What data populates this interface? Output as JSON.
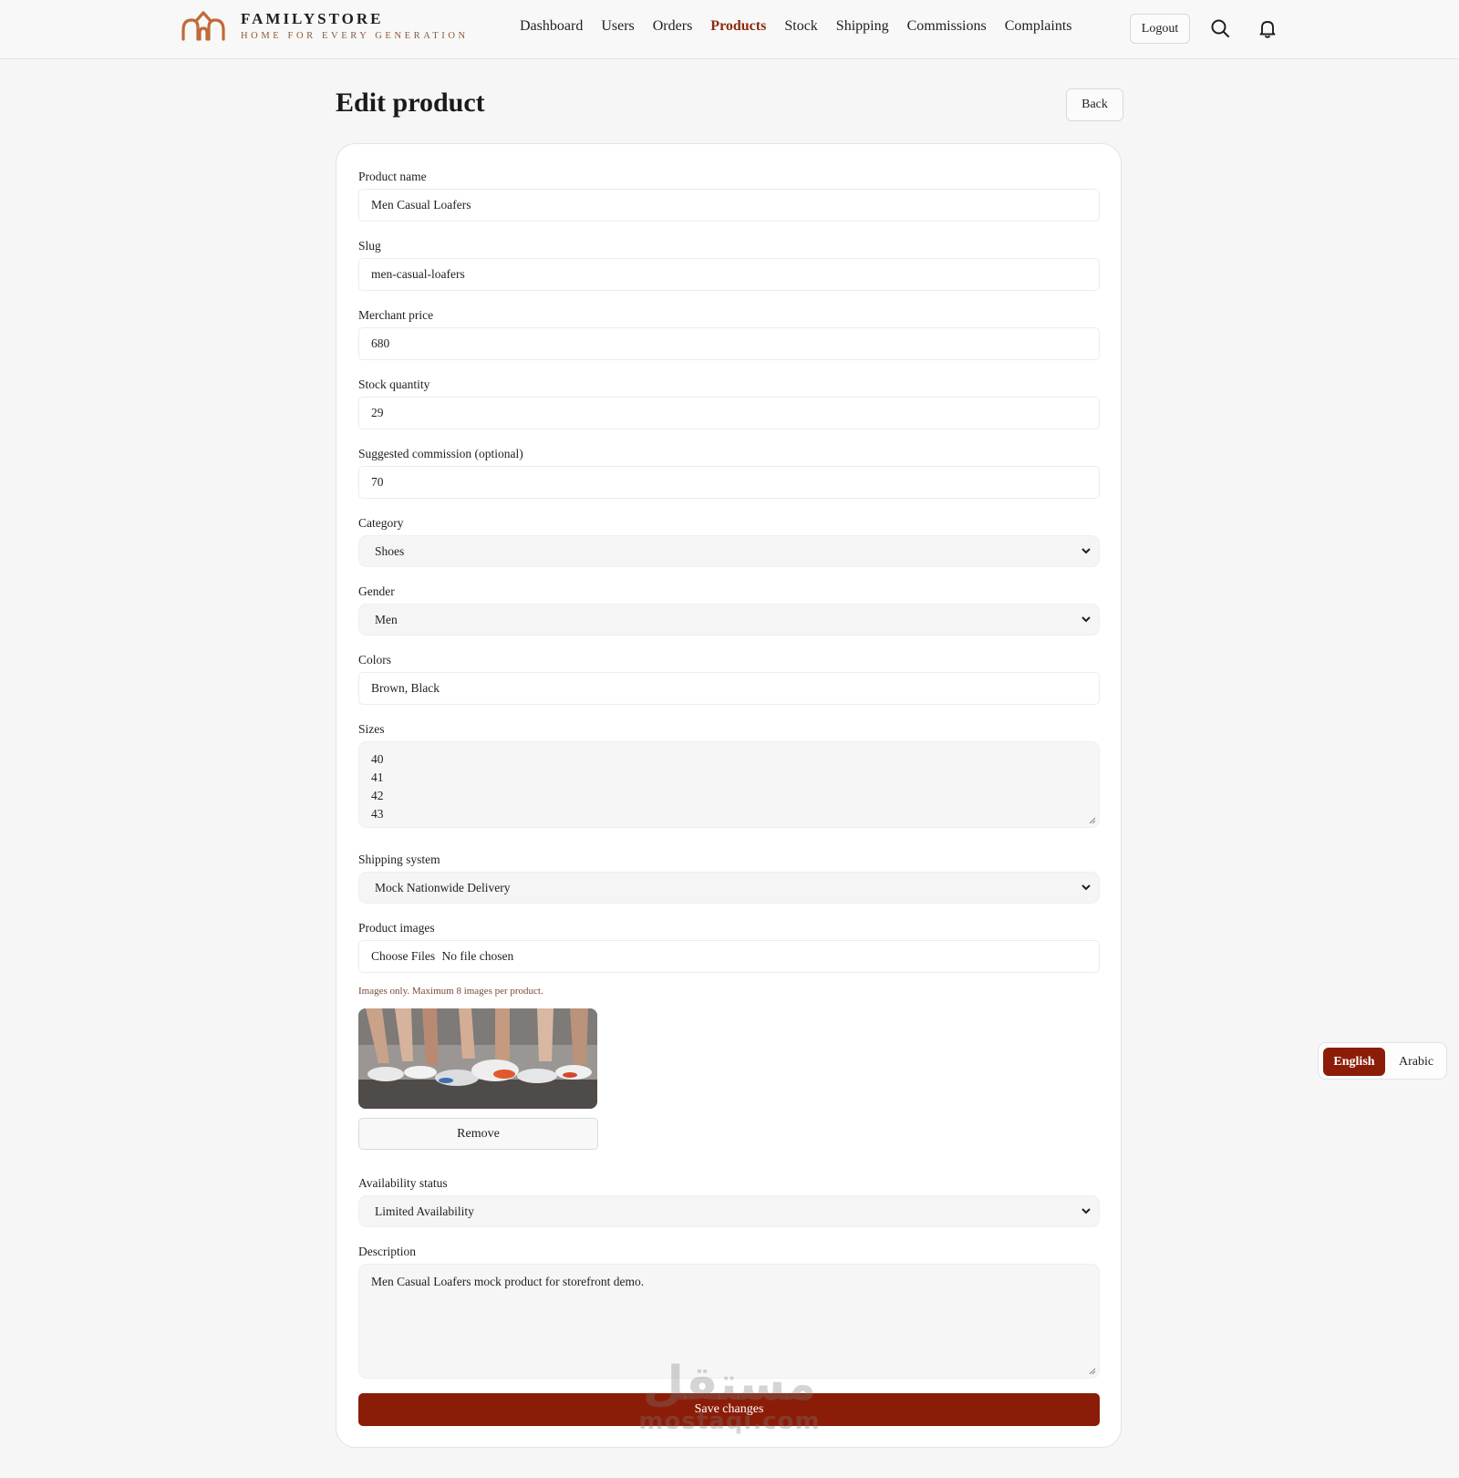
{
  "brand": {
    "name": "FAMILYSTORE",
    "tagline": "HOME FOR EVERY GENERATION",
    "logo_icon": "house-arches-logo-icon",
    "accent_color": "#c06a3a"
  },
  "nav": {
    "items": [
      {
        "label": "Dashboard",
        "active": false
      },
      {
        "label": "Users",
        "active": false
      },
      {
        "label": "Orders",
        "active": false
      },
      {
        "label": "Products",
        "active": true
      },
      {
        "label": "Stock",
        "active": false
      },
      {
        "label": "Shipping",
        "active": false
      },
      {
        "label": "Commissions",
        "active": false
      },
      {
        "label": "Complaints",
        "active": false
      }
    ],
    "active_color": "#8b2a10"
  },
  "header": {
    "logout_label": "Logout",
    "search_icon": "search-icon",
    "bell_icon": "bell-icon"
  },
  "page": {
    "title": "Edit product",
    "back_label": "Back"
  },
  "form": {
    "product_name": {
      "label": "Product name",
      "value": "Men Casual Loafers"
    },
    "slug": {
      "label": "Slug",
      "value": "men-casual-loafers"
    },
    "merchant_price": {
      "label": "Merchant price",
      "value": "680"
    },
    "stock_quantity": {
      "label": "Stock quantity",
      "value": "29"
    },
    "suggested_commission": {
      "label": "Suggested commission (optional)",
      "value": "70"
    },
    "category": {
      "label": "Category",
      "value": "Shoes"
    },
    "gender": {
      "label": "Gender",
      "value": "Men"
    },
    "colors": {
      "label": "Colors",
      "value": "Brown, Black"
    },
    "sizes": {
      "label": "Sizes",
      "values": [
        "40",
        "41",
        "42",
        "43"
      ]
    },
    "shipping_system": {
      "label": "Shipping system",
      "value": "Mock Nationwide Delivery"
    },
    "product_images": {
      "label": "Product images",
      "choose_label": "Choose Files",
      "status": "No file chosen",
      "hint": "Images only. Maximum 8 images per product.",
      "remove_label": "Remove"
    },
    "availability_status": {
      "label": "Availability status",
      "value": "Limited Availability"
    },
    "description": {
      "label": "Description",
      "value": "Men Casual Loafers mock product for storefront demo."
    },
    "save_label": "Save changes",
    "save_color": "#8b1d08"
  },
  "language": {
    "english_label": "English",
    "arabic_label": "Arabic",
    "active": "English"
  },
  "watermark": {
    "arabic": "مستقل",
    "latin": "mostaqi.com"
  }
}
